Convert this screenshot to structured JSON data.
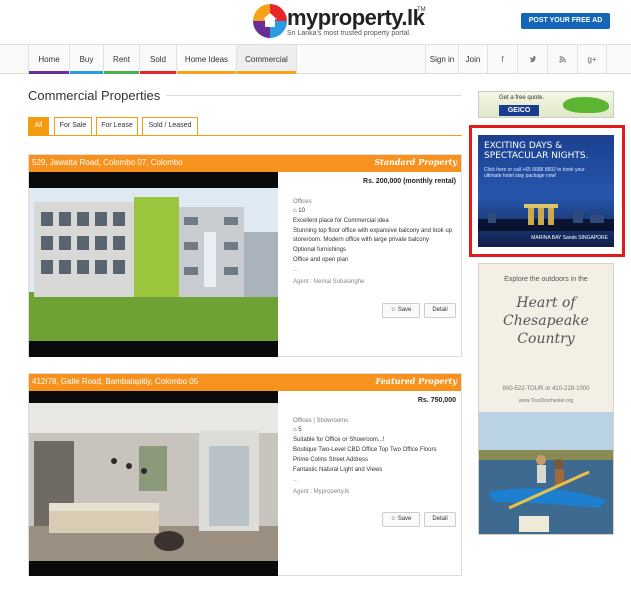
{
  "header": {
    "logo_text": "myproperty.lk",
    "logo_tm": "TM",
    "tagline": "Sri Lanka's most trusted property portal.",
    "post_ad_label": "POST YOUR FREE AD"
  },
  "nav": {
    "items": [
      {
        "label": "Home",
        "color": "#6a2f95"
      },
      {
        "label": "Buy",
        "color": "#2b9be0"
      },
      {
        "label": "Rent",
        "color": "#4caf50"
      },
      {
        "label": "Sold",
        "color": "#e8262a"
      },
      {
        "label": "Home Ideas",
        "color": "#f6a21b"
      },
      {
        "label": "Commercial",
        "color": "#f6a21b"
      }
    ],
    "signin_label": "Sign in",
    "join_label": "Join",
    "social": [
      "f",
      "t",
      "rss",
      "g+"
    ]
  },
  "page": {
    "title": "Commercial Properties",
    "filters": [
      "All",
      "For Sale",
      "For Lease",
      "Sold / Leased"
    ]
  },
  "listings": [
    {
      "address": "529, Jawatta Road, Colombo 07, Colombo",
      "type": "Standard Property",
      "price": "Rs. 200,000 (monthly rental)",
      "category": "Offices",
      "count": "10",
      "desc": "Excellent place for Commercial idea",
      "features": [
        "Stunning top floor office with expansive balcony and look up storeroom. Modern office with large private balcony",
        "Optional furnishings",
        "Office and open plan"
      ],
      "separator": "--",
      "agent": "Agent : Nemal Subasinghe",
      "save_label": "Save",
      "detail_label": "Detail"
    },
    {
      "address": "412/78, Galle Road, Bambalapitiy, Colombo 05",
      "type": "Featured Property",
      "price": "Rs. 750,000",
      "category": "Offices  |  Showrooms",
      "count": "5",
      "desc": "Suitable for Office or Showroom...!",
      "features": [
        "Boutique Two-Level CBD Office Top Two Office Floors",
        "Prime Colins Street Address",
        "Fantastic Natural Light and Views"
      ],
      "separator": "--",
      "agent": "Agent : Myproperty.lk",
      "save_label": "Save",
      "detail_label": "Detail"
    }
  ],
  "ads": {
    "geico": {
      "text": "Get a free quote.",
      "brand": "GEICO"
    },
    "marina": {
      "headline": "EXCITING DAYS & SPECTACULAR NIGHTS.",
      "body": "Click here or call +65 6688 8892 to book your ultimate hotel stay package now!",
      "brand": "MARINA BAY Sands SINGAPORE"
    },
    "chesapeake": {
      "tagline": "Explore the outdoors in the",
      "headline": "Heart of Chesapeake Country",
      "phone": "800-522-TOUR or 410-228-1000",
      "url": "www.TourDorchester.org"
    }
  }
}
